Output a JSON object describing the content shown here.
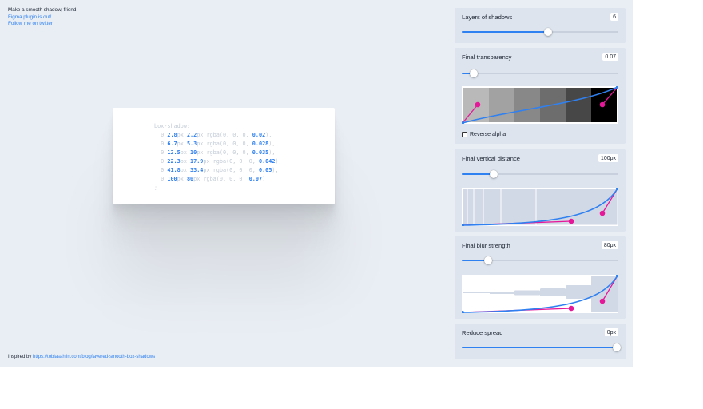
{
  "intro": {
    "title": "Make a smooth shadow, friend.",
    "link_figma": "Figma plugin is out!",
    "link_twitter": "Follow me on twitter"
  },
  "footer": {
    "text": "Inspired by ",
    "link": "https://tobiasahlin.com/blog/layered-smooth-box-shadows"
  },
  "code": {
    "prop": "box-shadow:",
    "layers": [
      {
        "y": "2.8",
        "blur": "2.2",
        "alpha": "0.02"
      },
      {
        "y": "6.7",
        "blur": "5.3",
        "alpha": "0.028"
      },
      {
        "y": "12.5",
        "blur": "10",
        "alpha": "0.035"
      },
      {
        "y": "22.3",
        "blur": "17.9",
        "alpha": "0.042"
      },
      {
        "y": "41.8",
        "blur": "33.4",
        "alpha": "0.05"
      },
      {
        "y": "100",
        "blur": "80",
        "alpha": "0.07"
      }
    ],
    "close": ";"
  },
  "controls": {
    "layers": {
      "label": "Layers of shadows",
      "value": "6",
      "position": 0.55
    },
    "transparency": {
      "label": "Final transparency",
      "value": "0.07",
      "position": 0.07,
      "reverse_label": "Reverse alpha"
    },
    "distance": {
      "label": "Final vertical distance",
      "value": "100px",
      "position": 0.2
    },
    "blur": {
      "label": "Final blur strength",
      "value": "80px",
      "position": 0.16
    },
    "spread": {
      "label": "Reduce spread",
      "value": "0px",
      "position": 1.0
    }
  },
  "colors": {
    "accent": "#2f80f0",
    "handle": "#e6189a",
    "background": "#e9eef4",
    "panel": "#dde4ee"
  }
}
